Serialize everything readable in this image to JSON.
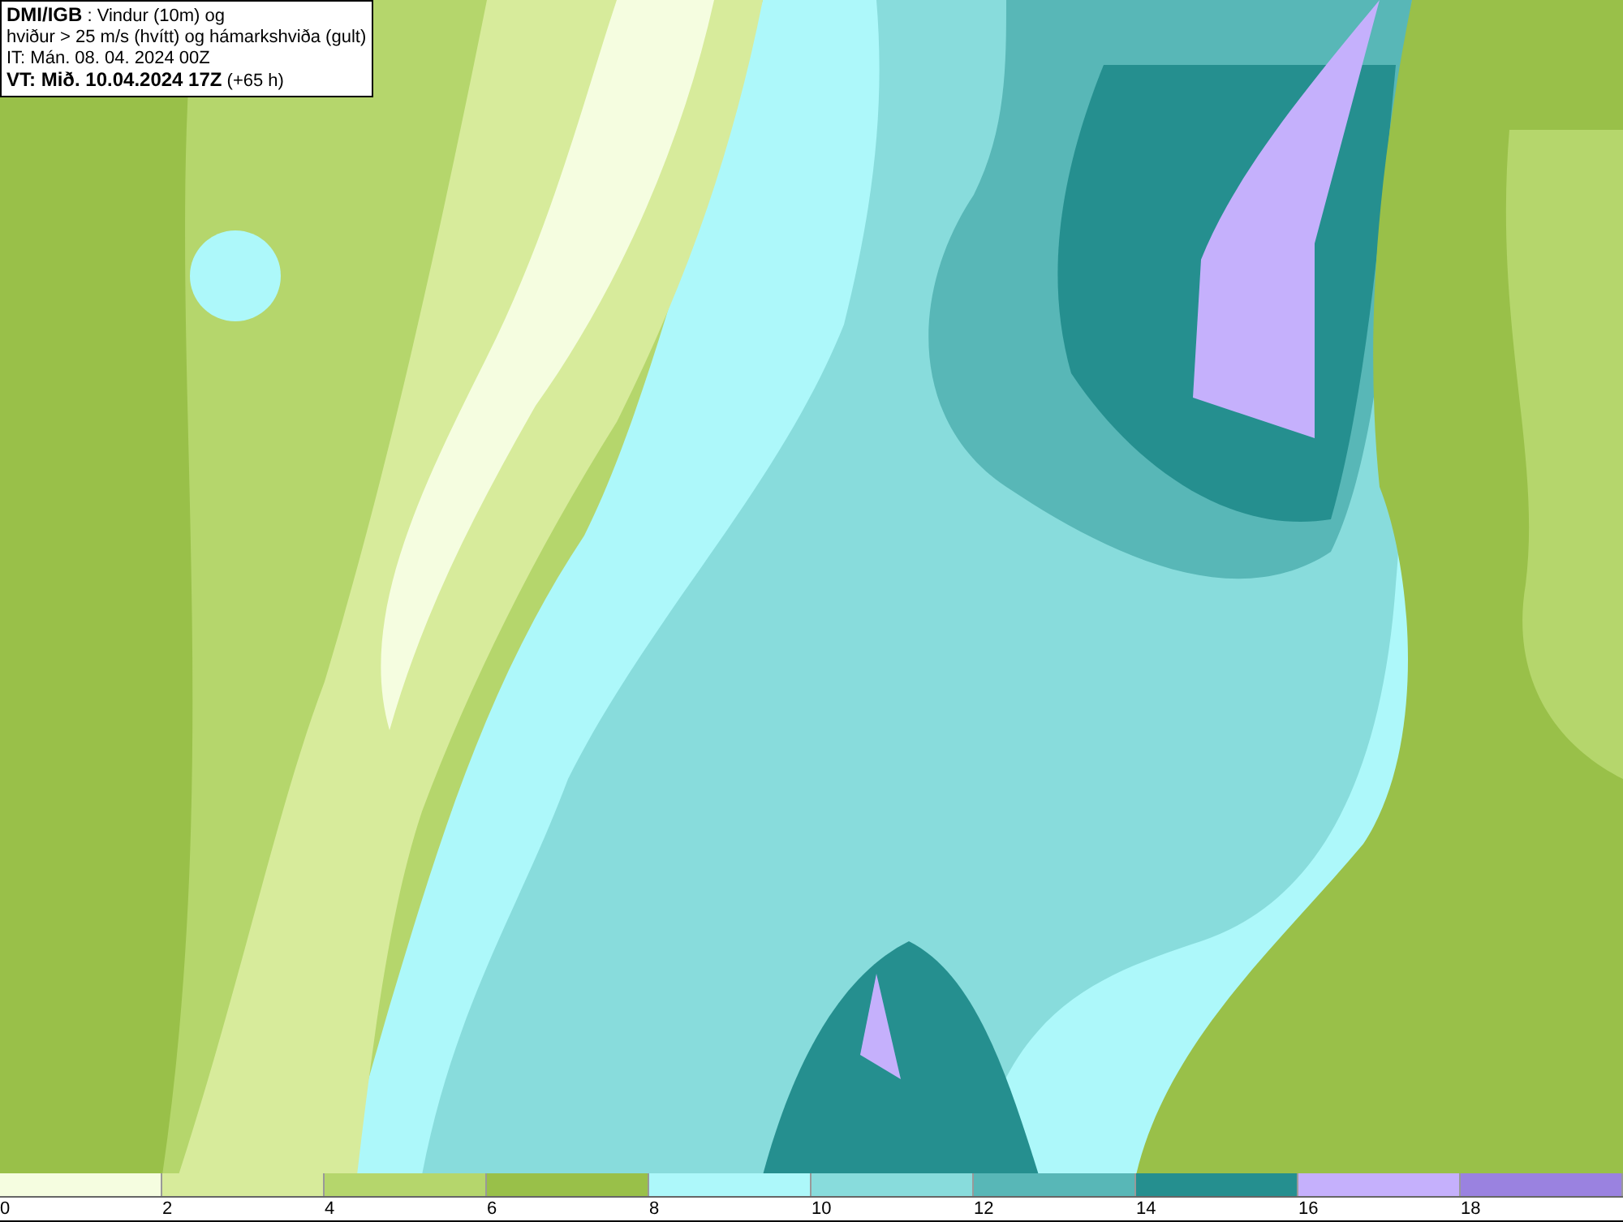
{
  "title_box": {
    "lines": [
      "**DMI/IGB** : Vindur (10m) og",
      "hviður > 25 m/s (hvítt) og hámarkshviða (gult)",
      "IT: Mán. 08. 04. 2024 00Z",
      "**VT: Mið. 10.04.2024 17Z** (+65 h)"
    ]
  },
  "legend": {
    "segments": [
      {
        "label": "0",
        "color": "#f5fde0"
      },
      {
        "label": "2",
        "color": "#d7eb9b"
      },
      {
        "label": "4",
        "color": "#b5d66c"
      },
      {
        "label": "6",
        "color": "#99c049"
      },
      {
        "label": "8",
        "color": "#adf8fa"
      },
      {
        "label": "10",
        "color": "#88dcdc"
      },
      {
        "label": "12",
        "color": "#58b7b7"
      },
      {
        "label": "14",
        "color": "#258f8f"
      },
      {
        "label": "16",
        "color": "#c5b0fc"
      },
      {
        "label": "18",
        "color": "#9a82e0"
      }
    ]
  }
}
